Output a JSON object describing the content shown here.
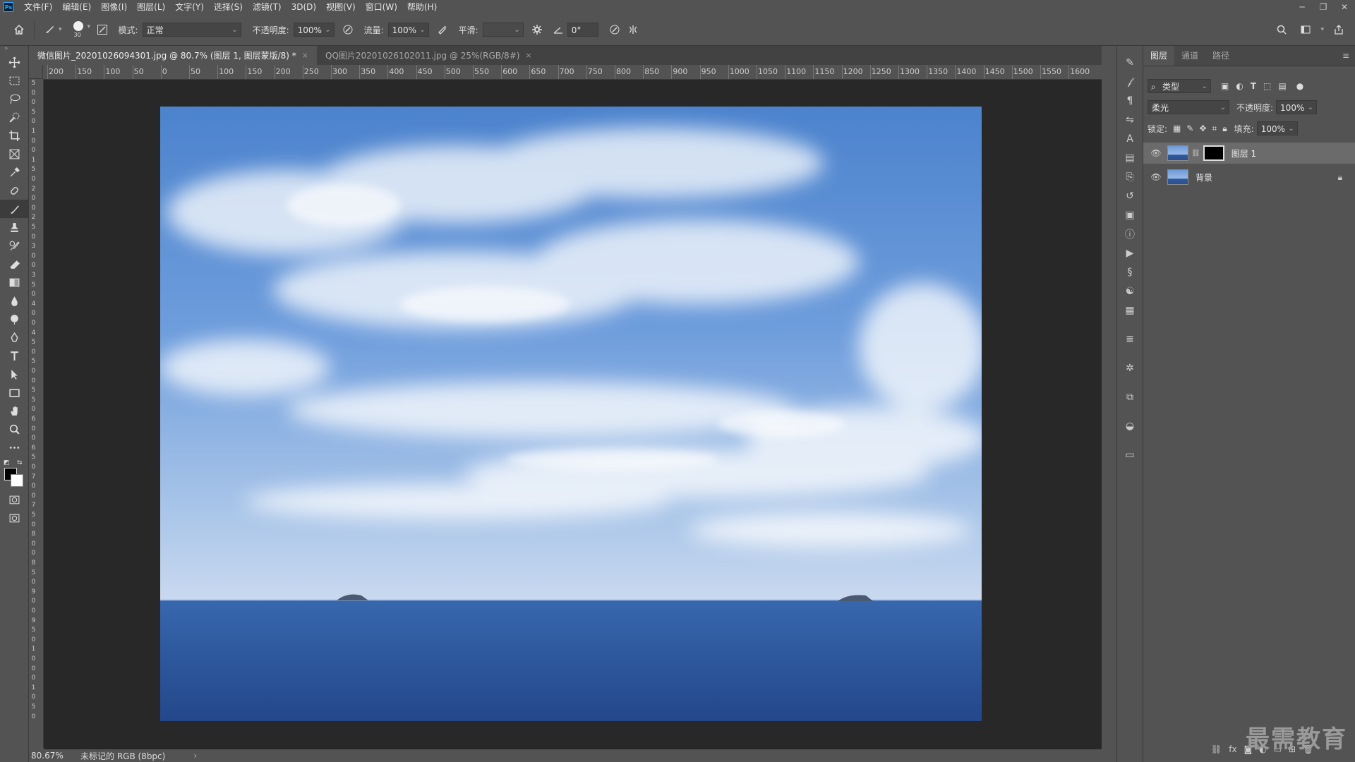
{
  "app": {
    "logo": "Ps"
  },
  "menu": [
    "文件(F)",
    "编辑(E)",
    "图像(I)",
    "图层(L)",
    "文字(Y)",
    "选择(S)",
    "滤镜(T)",
    "3D(D)",
    "视图(V)",
    "窗口(W)",
    "帮助(H)"
  ],
  "options": {
    "brush_size": "30",
    "mode_label": "模式:",
    "mode_value": "正常",
    "opacity_label": "不透明度:",
    "opacity_value": "100%",
    "flow_label": "流量:",
    "flow_value": "100%",
    "smooth_label": "平滑:",
    "smooth_value": "",
    "angle_value": "0°"
  },
  "tabs": [
    {
      "label": "微信图片_20201026094301.jpg @ 80.7% (图层 1, 图层蒙版/8) *",
      "close": "×"
    },
    {
      "label": "QQ图片20201026102011.jpg @ 25%(RGB/8#)",
      "close": "×"
    }
  ],
  "ruler_h": [
    "200",
    "150",
    "100",
    "50",
    "0",
    "50",
    "100",
    "150",
    "200",
    "250",
    "300",
    "350",
    "400",
    "450",
    "500",
    "550",
    "600",
    "650",
    "700",
    "750",
    "800",
    "850",
    "900",
    "950",
    "1000",
    "1050",
    "1100",
    "1150",
    "1200",
    "1250",
    "1300",
    "1350",
    "1400",
    "1450",
    "1500",
    "1550",
    "1600"
  ],
  "ruler_v": [
    "5",
    "0",
    "0",
    "5",
    "0",
    "1",
    "0",
    "0",
    "1",
    "5",
    "0",
    "2",
    "0",
    "0",
    "2",
    "5",
    "0",
    "3",
    "0",
    "0",
    "3",
    "5",
    "0",
    "4",
    "0",
    "0",
    "4",
    "5",
    "0",
    "5",
    "0",
    "0",
    "5",
    "5",
    "0",
    "6",
    "0",
    "0",
    "6",
    "5",
    "0",
    "7",
    "0",
    "0",
    "7",
    "5",
    "0",
    "8",
    "0",
    "0",
    "8",
    "5",
    "0",
    "9",
    "0",
    "0",
    "9",
    "5",
    "0",
    "1",
    "0",
    "0",
    "0",
    "1",
    "0",
    "5",
    "0"
  ],
  "status": {
    "zoom": "80.67%",
    "info": "未标记的 RGB (8bpc)",
    "arrow": "›"
  },
  "layers_panel": {
    "tabs": [
      "图层",
      "通道",
      "路径"
    ],
    "filter_label": "类型",
    "blend_mode": "柔光",
    "opacity_label": "不透明度:",
    "opacity_value": "100%",
    "lock_label": "锁定:",
    "fill_label": "填充:",
    "fill_value": "100%",
    "layers": [
      {
        "name": "图层 1",
        "visible": true,
        "has_mask": true,
        "selected": true
      },
      {
        "name": "背景",
        "visible": true,
        "locked": true
      }
    ]
  },
  "watermark": "最需教育",
  "colors": {
    "sky_top": "#4f86cf",
    "sea": "#2d5aa1",
    "ui_bg": "#535353",
    "canvas_bg": "#282828"
  }
}
